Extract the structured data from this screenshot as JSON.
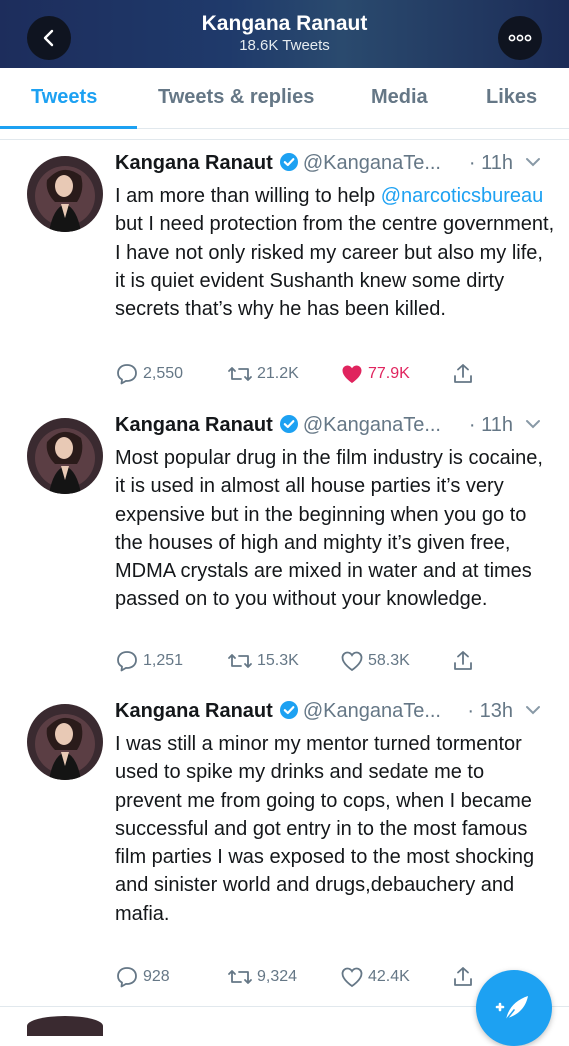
{
  "header": {
    "title": "Kangana Ranaut",
    "subtitle": "18.6K Tweets",
    "back_icon": "back-arrow-icon",
    "more_icon": "ellipsis-icon"
  },
  "tabs": [
    {
      "label": "Tweets",
      "active": true
    },
    {
      "label": "Tweets & replies",
      "active": false
    },
    {
      "label": "Media",
      "active": false
    },
    {
      "label": "Likes",
      "active": false
    }
  ],
  "tweets": [
    {
      "name": "Kangana Ranaut",
      "handle": "@KanganaTe...",
      "time": "· 11h",
      "text_pre": "I am more than willing to help ",
      "mention": "@narcoticsbureau",
      "text_post": " but I need protection from the centre government, I have not only risked my career but also my life, it is quiet evident Sushanth knew some dirty secrets that’s why he has been killed.",
      "replies": "2,550",
      "retweets": "21.2K",
      "likes": "77.9K",
      "liked": true
    },
    {
      "name": "Kangana Ranaut",
      "handle": "@KanganaTe...",
      "time": "· 11h",
      "text": "Most popular drug in the film industry is cocaine, it is used in almost all house parties it’s very expensive but in the beginning when you go to the houses of high and mighty it’s given free, MDMA crystals are mixed in water and at times passed on to you without your knowledge.",
      "replies": "1,251",
      "retweets": "15.3K",
      "likes": "58.3K",
      "liked": false
    },
    {
      "name": "Kangana Ranaut",
      "handle": "@KanganaTe...",
      "time": "· 13h",
      "text": "I was still a minor my mentor turned tormentor used to spike my drinks and sedate me to prevent me from going to cops, when I became successful and got entry in to the most famous film parties I was exposed to the most shocking and sinister world and drugs,debauchery and mafia.",
      "replies": "928",
      "retweets": "9,324",
      "likes": "42.4K",
      "liked": false
    }
  ],
  "colors": {
    "accent": "#1da1f2",
    "like": "#e0245e",
    "muted": "#657786"
  },
  "fab_icon": "compose-tweet-icon"
}
